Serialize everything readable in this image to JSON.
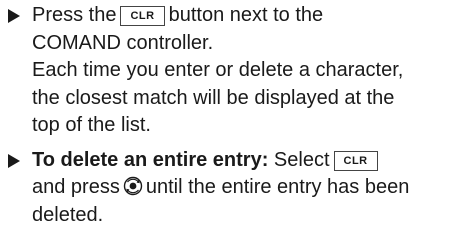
{
  "steps": [
    {
      "line1_before": "Press the",
      "key": "CLR",
      "line1_after": "button next to the",
      "line2": "COMAND controller.",
      "note_lines": [
        "Each time you enter or delete a character,",
        "the closest match will be displayed at the",
        "top of the list."
      ]
    },
    {
      "bold_label": "To delete an entire entry:",
      "line1_after_bold": "Select",
      "key": "CLR",
      "line2_before": "and press",
      "control_icon": "rotate-press-controller-icon",
      "line2_after": "until the entire entry has been",
      "line3": "deleted."
    }
  ]
}
